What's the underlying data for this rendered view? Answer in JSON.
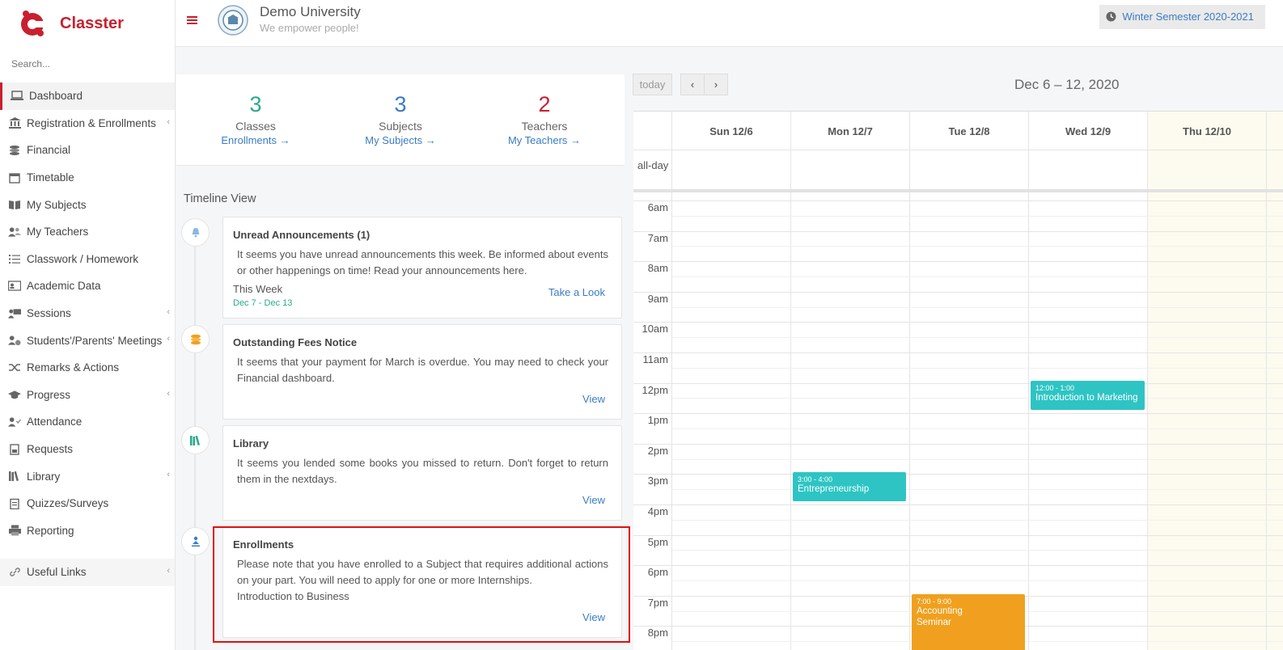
{
  "brand": {
    "name": "Classter"
  },
  "search": {
    "placeholder": "Search..."
  },
  "nav": [
    {
      "label": "Dashboard",
      "icon": "laptop-icon",
      "active": true,
      "caret": false
    },
    {
      "label": "Registration & Enrollments",
      "icon": "institution-icon",
      "caret": true
    },
    {
      "label": "Financial",
      "icon": "coins-icon",
      "caret": false
    },
    {
      "label": "Timetable",
      "icon": "calendar-icon",
      "caret": false
    },
    {
      "label": "My Subjects",
      "icon": "book-icon",
      "caret": false
    },
    {
      "label": "My Teachers",
      "icon": "users-icon",
      "caret": false
    },
    {
      "label": "Classwork / Homework",
      "icon": "list-icon",
      "caret": false
    },
    {
      "label": "Academic Data",
      "icon": "id-card-icon",
      "caret": false
    },
    {
      "label": "Sessions",
      "icon": "presentation-icon",
      "caret": true
    },
    {
      "label": "Students'/Parents' Meetings",
      "icon": "user-clock-icon",
      "caret": true
    },
    {
      "label": "Remarks & Actions",
      "icon": "shuffle-icon",
      "caret": false
    },
    {
      "label": "Progress",
      "icon": "graduation-cap-icon",
      "caret": true
    },
    {
      "label": "Attendance",
      "icon": "user-check-icon",
      "caret": false
    },
    {
      "label": "Requests",
      "icon": "document-icon",
      "caret": false
    },
    {
      "label": "Library",
      "icon": "books-icon",
      "caret": true
    },
    {
      "label": "Quizzes/Surveys",
      "icon": "clipboard-icon",
      "caret": false
    },
    {
      "label": "Reporting",
      "icon": "printer-icon",
      "caret": false
    }
  ],
  "useful_links": {
    "label": "Useful Links",
    "icon": "link-icon"
  },
  "header": {
    "menu_icon": "hamburger-icon",
    "university": "Demo University",
    "slogan": "We empower people!",
    "semester": "Winter Semester 2020-2021",
    "semester_icon": "clock-icon"
  },
  "stats": [
    {
      "number": "3",
      "label": "Classes",
      "link": "Enrollments",
      "color": "#2aaa8a"
    },
    {
      "number": "3",
      "label": "Subjects",
      "link": "My Subjects",
      "color": "#3a7cc4"
    },
    {
      "number": "2",
      "label": "Teachers",
      "link": "My Teachers",
      "color": "#c8202f"
    }
  ],
  "timeline": {
    "title": "Timeline View",
    "cards": [
      {
        "icon": "bell-icon",
        "title": "Unread Announcements (1)",
        "text": "It seems you have unread announcements this week. Be informed about events or other happenings on time! Read your announcements here.",
        "week": "This Week",
        "dates": "Dec 7 - Dec 13",
        "link": "Take a Look"
      },
      {
        "icon": "coins-stack-icon",
        "title": "Outstanding Fees Notice",
        "text": "It seems that your payment for March is overdue. You may need to check your Financial dashboard.",
        "link": "View"
      },
      {
        "icon": "books-icon",
        "title": "Library",
        "text": "It seems you lended some books you missed to return. Don't forget to return them in the nextdays.",
        "link": "View"
      },
      {
        "icon": "person-upload-icon",
        "title": "Enrollments",
        "text": "Please note that you have enrolled to a Subject that requires additional actions on your part. You will need to apply for one or more Internships.",
        "text2": "Introduction to Business",
        "link": "View"
      }
    ]
  },
  "calendar": {
    "today_label": "today",
    "prev_icon": "chevron-left-icon",
    "next_icon": "chevron-right-icon",
    "title": "Dec 6 – 12, 2020",
    "days": [
      "Sun 12/6",
      "Mon 12/7",
      "Tue 12/8",
      "Wed 12/9",
      "Thu 12/10"
    ],
    "allday_label": "all-day",
    "hours": [
      "6am",
      "7am",
      "8am",
      "9am",
      "10am",
      "11am",
      "12pm",
      "1pm",
      "2pm",
      "3pm",
      "4pm",
      "5pm",
      "6pm",
      "7pm",
      "8pm"
    ],
    "events": [
      {
        "time": "12:00 - 1:00",
        "name": "Introduction to Marketing",
        "color": "#2ec4c4"
      },
      {
        "time": "3:00 - 4:00",
        "name": "Entrepreneurship",
        "color": "#2ec4c4"
      },
      {
        "time": "7:00 - 9:00",
        "name": "Accounting Seminar",
        "color": "#f0a01e"
      }
    ]
  }
}
